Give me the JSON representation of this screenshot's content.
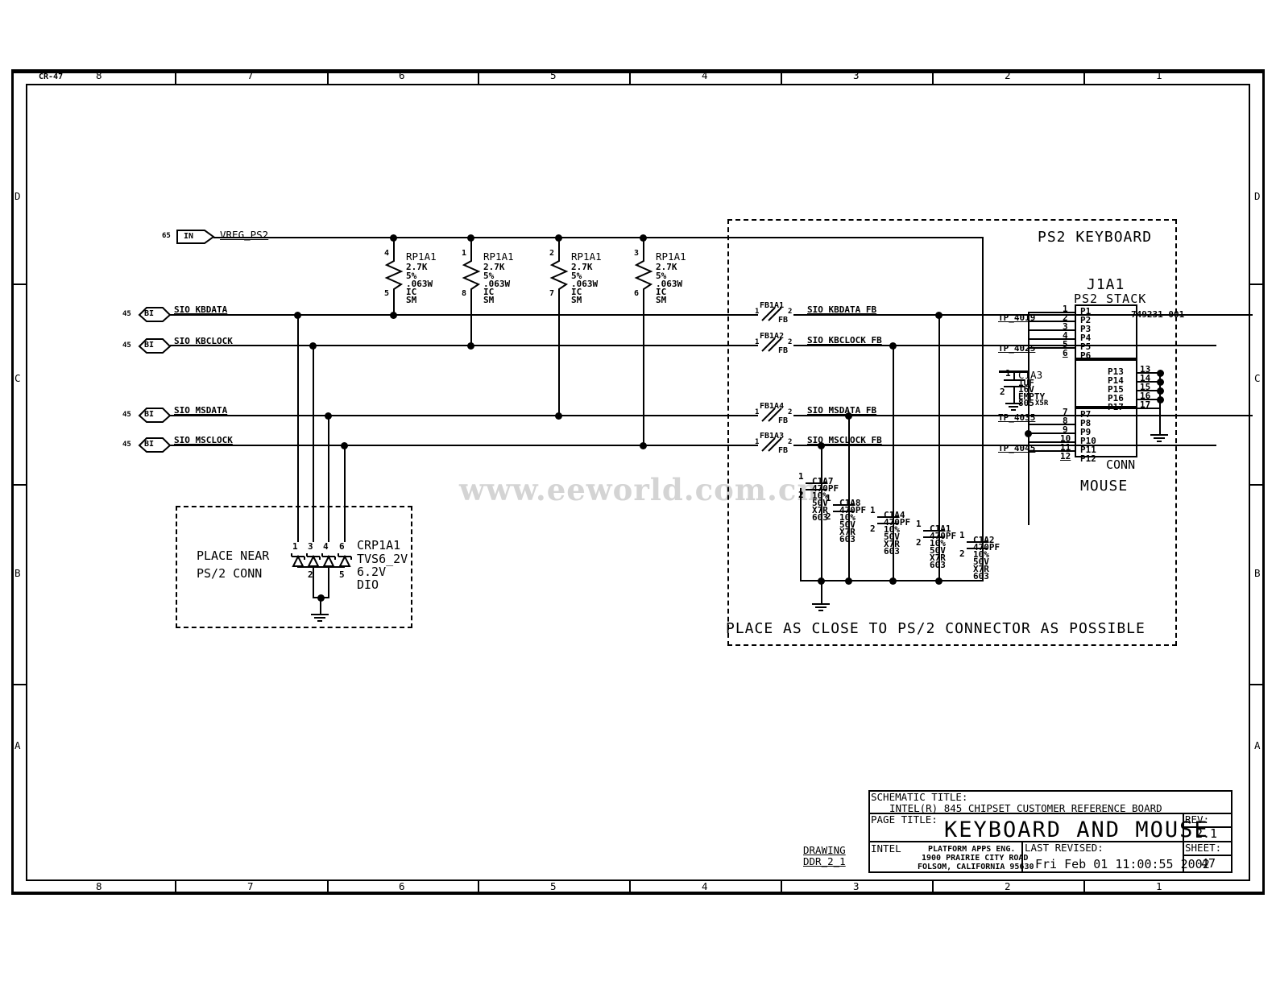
{
  "sheet": {
    "corner_label": "CR-47",
    "zones_top": [
      "8",
      "7",
      "6",
      "5",
      "4",
      "3",
      "2",
      "1"
    ],
    "zones_bottom": [
      "8",
      "7",
      "6",
      "5",
      "4",
      "3",
      "2",
      "1"
    ],
    "zones_left": [
      "D",
      "C",
      "B",
      "A"
    ],
    "zones_right": [
      "D",
      "C",
      "B",
      "A"
    ],
    "watermark": "www.eeworld.com.cn"
  },
  "title_block": {
    "schematic_title_label": "SCHEMATIC TITLE:",
    "schematic_title": "INTEL(R) 845 CHIPSET CUSTOMER REFERENCE BOARD",
    "page_title_label": "PAGE TITLE:",
    "page_title": "KEYBOARD AND MOUSE",
    "rev_label": "REV:",
    "rev": "2.1",
    "sheet_label": "SHEET:",
    "sheet_number": "47",
    "company": "INTEL",
    "dept": "PLATFORM APPS ENG.",
    "address1": "1900 PRAIRIE CITY ROAD",
    "address2": "FOLSOM, CALIFORNIA 95630",
    "last_revised_label": "LAST REVISED:",
    "last_revised": "Fri Feb 01 11:00:55 2002",
    "drawing_label": "DRAWING",
    "drawing_name": "DDR_2_1"
  },
  "ports": [
    {
      "sheet": "65",
      "dir": "IN",
      "name": "VREG_PS2"
    },
    {
      "sheet": "45",
      "dir": "BI",
      "name": "SIO_KBDATA"
    },
    {
      "sheet": "45",
      "dir": "BI",
      "name": "SIO_KBCLOCK"
    },
    {
      "sheet": "45",
      "dir": "BI",
      "name": "SIO_MSDATA"
    },
    {
      "sheet": "45",
      "dir": "BI",
      "name": "SIO_MSCLOCK"
    }
  ],
  "resistors": [
    {
      "ref": "RP1A1",
      "pin_top": "4",
      "pin_bot": "5",
      "value": "2.7K",
      "tol": "5%",
      "power": ".063W",
      "type": "IC",
      "mount": "SM"
    },
    {
      "ref": "RP1A1",
      "pin_top": "1",
      "pin_bot": "8",
      "value": "2.7K",
      "tol": "5%",
      "power": ".063W",
      "type": "IC",
      "mount": "SM"
    },
    {
      "ref": "RP1A1",
      "pin_top": "2",
      "pin_bot": "7",
      "value": "2.7K",
      "tol": "5%",
      "power": ".063W",
      "type": "IC",
      "mount": "SM"
    },
    {
      "ref": "RP1A1",
      "pin_top": "3",
      "pin_bot": "6",
      "value": "2.7K",
      "tol": "5%",
      "power": ".063W",
      "type": "IC",
      "mount": "SM"
    }
  ],
  "ferrites": [
    {
      "ref": "FB1A1",
      "pin1": "1",
      "pin2": "2",
      "type": "FB",
      "out_net": "SIO_KBDATA_FB"
    },
    {
      "ref": "FB1A2",
      "pin1": "1",
      "pin2": "2",
      "type": "FB",
      "out_net": "SIO_KBCLOCK_FB"
    },
    {
      "ref": "FB1A4",
      "pin1": "1",
      "pin2": "2",
      "type": "FB",
      "out_net": "SIO_MSDATA_FB"
    },
    {
      "ref": "FB1A3",
      "pin1": "1",
      "pin2": "2",
      "type": "FB",
      "out_net": "SIO_MSCLOCK_FB"
    }
  ],
  "test_points": [
    "TP_4019",
    "TP_4025",
    "TP_4035",
    "TP_4045"
  ],
  "connector": {
    "ref": "J1A1",
    "name": "PS2 STACK",
    "part_number": "749231-001",
    "footprint": "CONN",
    "group_top_label": "PS2 KEYBOARD",
    "group_bottom_label": "MOUSE",
    "pins_top": [
      {
        "num": "1",
        "name": "P1"
      },
      {
        "num": "2",
        "name": "P2"
      },
      {
        "num": "3",
        "name": "P3"
      },
      {
        "num": "4",
        "name": "P4"
      },
      {
        "num": "5",
        "name": "P5"
      },
      {
        "num": "6",
        "name": "P6"
      }
    ],
    "pins_shield": [
      {
        "num": "13",
        "name": "P13"
      },
      {
        "num": "14",
        "name": "P14"
      },
      {
        "num": "15",
        "name": "P15"
      },
      {
        "num": "16",
        "name": "P16"
      },
      {
        "num": "17",
        "name": "P17"
      }
    ],
    "pins_bottom": [
      {
        "num": "7",
        "name": "P7"
      },
      {
        "num": "8",
        "name": "P8"
      },
      {
        "num": "9",
        "name": "P9"
      },
      {
        "num": "10",
        "name": "P10"
      },
      {
        "num": "11",
        "name": "P11"
      },
      {
        "num": "12",
        "name": "P12"
      }
    ]
  },
  "cap_c1a3": {
    "ref": "C1A3",
    "pin1": "1",
    "pin2": "2",
    "value": "1UF",
    "voltage": "16V",
    "status": "EMPTY",
    "package": "805",
    "dielectric": "X5R"
  },
  "caps": [
    {
      "ref": "C1A7",
      "pin1": "1",
      "pin2": "2",
      "value": "470PF",
      "tol": "10%",
      "voltage": "50V",
      "dielectric": "X7R",
      "package": "603"
    },
    {
      "ref": "C1A8",
      "pin1": "1",
      "pin2": "2",
      "value": "470PF",
      "tol": "10%",
      "voltage": "50V",
      "dielectric": "X7R",
      "package": "603"
    },
    {
      "ref": "C1A4",
      "pin1": "1",
      "pin2": "2",
      "value": "470PF",
      "tol": "10%",
      "voltage": "50V",
      "dielectric": "X7R",
      "package": "603"
    },
    {
      "ref": "C1A1",
      "pin1": "1",
      "pin2": "2",
      "value": "470PF",
      "tol": "10%",
      "voltage": "50V",
      "dielectric": "X7R",
      "package": "603"
    },
    {
      "ref": "C1A2",
      "pin1": "1",
      "pin2": "2",
      "value": "470PF",
      "tol": "10%",
      "voltage": "50V",
      "dielectric": "X7R",
      "package": "603"
    }
  ],
  "tvs": {
    "ref": "CRP1A1",
    "part": "TVS6_2V",
    "voltage": "6.2V",
    "type": "DIO",
    "anode_pins": [
      "1",
      "3",
      "4",
      "6"
    ],
    "cathode_pins": [
      "2",
      "5"
    ],
    "note_line1": "PLACE NEAR",
    "note_line2": "PS/2 CONN"
  },
  "notes": {
    "place_close": "PLACE AS CLOSE TO PS/2 CONNECTOR AS POSSIBLE"
  }
}
